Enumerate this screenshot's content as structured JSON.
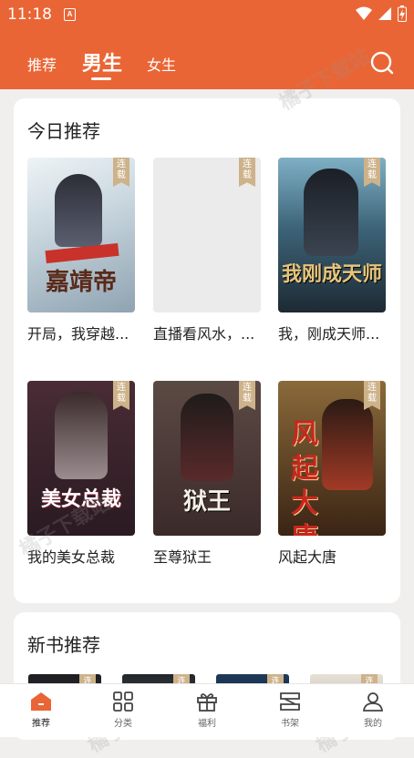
{
  "status": {
    "time": "11:18",
    "sim_label": "A"
  },
  "tabs": [
    {
      "label": "推荐"
    },
    {
      "label": "男生"
    },
    {
      "label": "女生"
    }
  ],
  "today": {
    "title": "今日推荐",
    "books": [
      {
        "title": "开局，我穿越成为了嘉靖帝的兄弟",
        "display": "开局，我穿越...",
        "badge": "连载",
        "cover_text": "嘉靖帝"
      },
      {
        "title": "直播看风水，...",
        "display": "直播看风水，...",
        "badge": "连载",
        "cover_text": ""
      },
      {
        "title": "我，刚成天师...",
        "display": "我，刚成天师...",
        "badge": "连载",
        "cover_text": "我刚成天师"
      },
      {
        "title": "我的美女总裁",
        "display": "我的美女总裁",
        "badge": "连载",
        "cover_text": "美女总裁"
      },
      {
        "title": "至尊狱王",
        "display": "至尊狱王",
        "badge": "连载",
        "cover_text": "狱王"
      },
      {
        "title": "风起大唐",
        "display": "风起大唐",
        "badge": "连载",
        "cover_text": "风起大唐"
      }
    ]
  },
  "newbooks": {
    "title": "新书推荐",
    "badges": [
      "连",
      "连",
      "连",
      "连"
    ]
  },
  "bottom_nav": [
    {
      "label": "推荐",
      "icon": "home-icon"
    },
    {
      "label": "分类",
      "icon": "grid-icon"
    },
    {
      "label": "福利",
      "icon": "gift-icon"
    },
    {
      "label": "书架",
      "icon": "bookshelf-icon"
    },
    {
      "label": "我的",
      "icon": "user-icon"
    }
  ],
  "watermark": "橘子下载站",
  "colors": {
    "accent": "#ea6535",
    "badge": "#cdb28a"
  }
}
